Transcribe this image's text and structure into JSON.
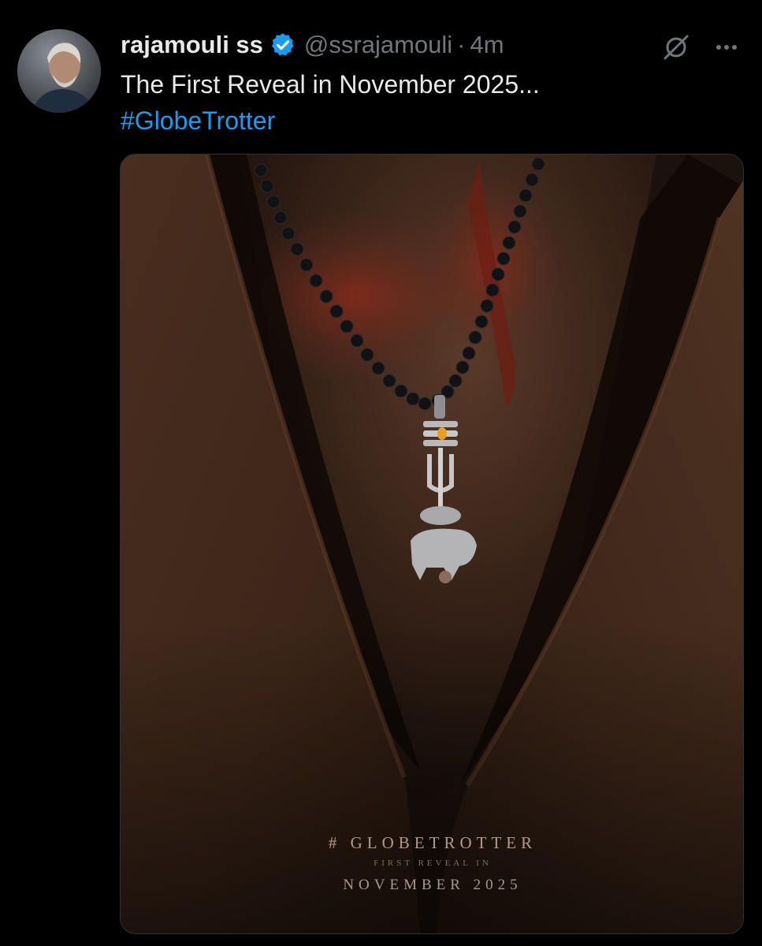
{
  "author": {
    "display_name": "rajamouli ss",
    "handle": "@ssrajamouli",
    "separator": "·",
    "time": "4m",
    "verified": true,
    "avatar_icon": "avatar-photo"
  },
  "post": {
    "text": "The First Reveal in November 2025...",
    "hashtag": "#GlobeTrotter"
  },
  "actions": {
    "grok_icon": "grok-icon",
    "more_icon": "more-icon"
  },
  "media": {
    "poster_title": "# GLOBETROTTER",
    "poster_subtitle": "FIRST REVEAL IN",
    "poster_date": "NOVEMBER 2025"
  },
  "colors": {
    "background": "#000000",
    "text_primary": "#e7e9ea",
    "text_secondary": "#71767b",
    "link": "#1d9bf0",
    "verified_badge": "#1d9bf0"
  }
}
